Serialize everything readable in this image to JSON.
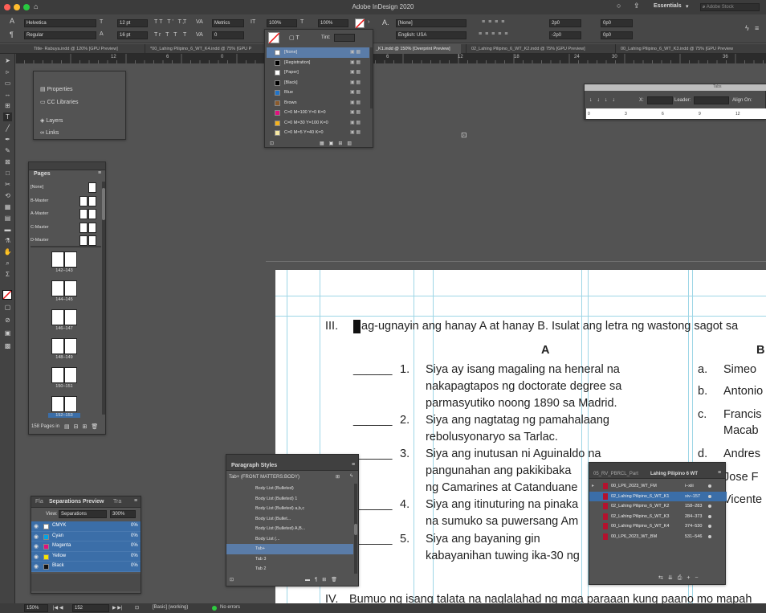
{
  "window": {
    "title": "Adobe InDesign 2020",
    "workspace": "Essentials",
    "search_placeholder": "Adobe Stock"
  },
  "control": {
    "font_family": "Helvetica",
    "font_style": "Regular",
    "font_size": "12 pt",
    "leading": "16 pt",
    "kerning": "Metrics",
    "tracking": "0",
    "vscale": "100%",
    "hscale": "100%",
    "char_style": "[None]",
    "language": "English: USA",
    "indent_left": "2p0",
    "indent_right": "-2p0",
    "space_before": "0p0",
    "space_after": "0p0",
    "tint_label": "Tint:"
  },
  "tabs": [
    "Title- Rabuya.indd @ 120% [GPU Preview]",
    "*00_Lahing Pilipino_6_WT_K4.indd @ 75% [GPU P",
    "_K1.indd @ 150% [Overprint Preview]",
    "02_Lahing Pilipino_6_WT_K2.indd @ 75% [GPU Preview]",
    "00_Lahing Pilipino_6_WT_K3.indd @ 75% [GPU Preview"
  ],
  "ruler": [
    "12",
    "6",
    "0",
    "6",
    "12",
    "18",
    "24",
    "30",
    "36"
  ],
  "swatches": {
    "tint_label": "Tint:",
    "items": [
      "[None]",
      "[Registration]",
      "[Paper]",
      "[Black]",
      "Blue",
      "Brown",
      "C=0 M=100 Y=0 K=0",
      "C=0 M=30 Y=100 K=0",
      "C=0 M=5 Y=40 K=0"
    ],
    "colors": [
      "#ffffff",
      "#000000",
      "#ffffff",
      "#000000",
      "#1f73c9",
      "#8b5a2b",
      "#e0107e",
      "#f6b21b",
      "#f7e8a2"
    ]
  },
  "props_panel": {
    "items": [
      "Properties",
      "CC Libraries",
      "Layers",
      "Links"
    ]
  },
  "pages_panel": {
    "title": "Pages",
    "masters": [
      "[None]",
      "B-Master",
      "A-Master",
      "C-Master",
      "D-Master"
    ],
    "spreads": [
      "142–143",
      "144–145",
      "146–147",
      "148–149",
      "150–151",
      "152–153"
    ],
    "count": "158 Pages in"
  },
  "tabs_panel": {
    "title": "Tabs",
    "x_label": "X:",
    "leader_label": "Leader:",
    "align_label": "Align On:",
    "ticks": [
      "0",
      "3",
      "6",
      "9",
      "12"
    ]
  },
  "separations": {
    "tabs": [
      "Fla",
      "Separations Preview",
      "Tra"
    ],
    "view_label": "View:",
    "view_value": "Separations",
    "zoom": "300%",
    "inks": [
      {
        "name": "CMYK",
        "value": "0%",
        "color": "#ffffff"
      },
      {
        "name": "Cyan",
        "value": "0%",
        "color": "#00a5e8"
      },
      {
        "name": "Magenta",
        "value": "0%",
        "color": "#e0107e"
      },
      {
        "name": "Yellow",
        "value": "0%",
        "color": "#f5e600"
      },
      {
        "name": "Black",
        "value": "0%",
        "color": "#111111"
      }
    ]
  },
  "para_styles": {
    "title": "Paragraph Styles",
    "current": "Tab+ (FRONT MATTERS:BODY)",
    "items": [
      "Body List (Bulleted)",
      "Body List (Bulleted) 1",
      "Body List (Bulleted) a,b,c",
      "Body List (Bullet...",
      "Body List (Bulleted) A,B...",
      "Body List (...",
      "Tab+",
      "Tab 3",
      "Tab 2"
    ],
    "selected": 6
  },
  "book": {
    "tabs": [
      "05_RV_PBRCL_Part",
      "Lahing Pilipino 6 WT"
    ],
    "rows": [
      {
        "name": "00_LP6_2023_WT_FM",
        "pages": "i–xiii"
      },
      {
        "name": "02_Lahing Pilipino_6_WT_K1",
        "pages": "xiv–157"
      },
      {
        "name": "02_Lahing Pilipino_6_WT_K2",
        "pages": "158–283"
      },
      {
        "name": "02_Lahing Pilipino_6_WT_K3",
        "pages": "284–373"
      },
      {
        "name": "00_Lahing Pilipino_6_WT_K4",
        "pages": "374–530"
      },
      {
        "name": "00_LP6_2023_WT_BM",
        "pages": "531–546"
      }
    ],
    "selected": 1
  },
  "document": {
    "instruction": "III.",
    "instruction_text": "ag-ugnayin ang hanay A at hanay B. Isulat ang letra ng wastong sagot sa",
    "colA": "A",
    "colB": "B",
    "blank": "______",
    "items": [
      {
        "num": "1.",
        "lines": [
          "Siya   ay   isang   magaling   na   heneral   na",
          "nakapagtapos  ng  doctorate  degree  sa",
          "parmasyutiko noong 1890 sa Madrid."
        ]
      },
      {
        "num": "2.",
        "lines": [
          "Siya    ang    nagtatag    ng    pamahalaang",
          "rebolusyonaryo sa Tarlac."
        ]
      },
      {
        "num": "3.",
        "lines": [
          "Siya    ang    inutusan    ni    Aguinaldo    na",
          "pangunahan ang pakikibaka",
          "ng Camarines at Catanduane"
        ]
      },
      {
        "num": "4.",
        "lines": [
          "Siya ang itinuturing na pinaka",
          "na sumuko sa puwersang Am"
        ]
      },
      {
        "num": "5.",
        "lines": [
          "Siya    ang    bayaning    gin",
          "kabayanihan tuwing ika-30 ng"
        ]
      }
    ],
    "answers": [
      {
        "l": "a.",
        "t": "Simeo"
      },
      {
        "l": "b.",
        "t": "Antonio"
      },
      {
        "l": "c.",
        "t": "Francis"
      },
      {
        "l": "",
        "t": "Macab"
      },
      {
        "l": "d.",
        "t": "Andres"
      },
      {
        "l": "",
        "t": "Jose F"
      },
      {
        "l": "",
        "t": "Vicente"
      }
    ],
    "next": "IV.",
    "next_text": "Bumuo ng isang talata na naglalahad ng mga paraaan kung paano mo mapah"
  },
  "status": {
    "zoom": "150%",
    "page": "152",
    "style": "[Basic] (working)",
    "errors": "No errors"
  }
}
